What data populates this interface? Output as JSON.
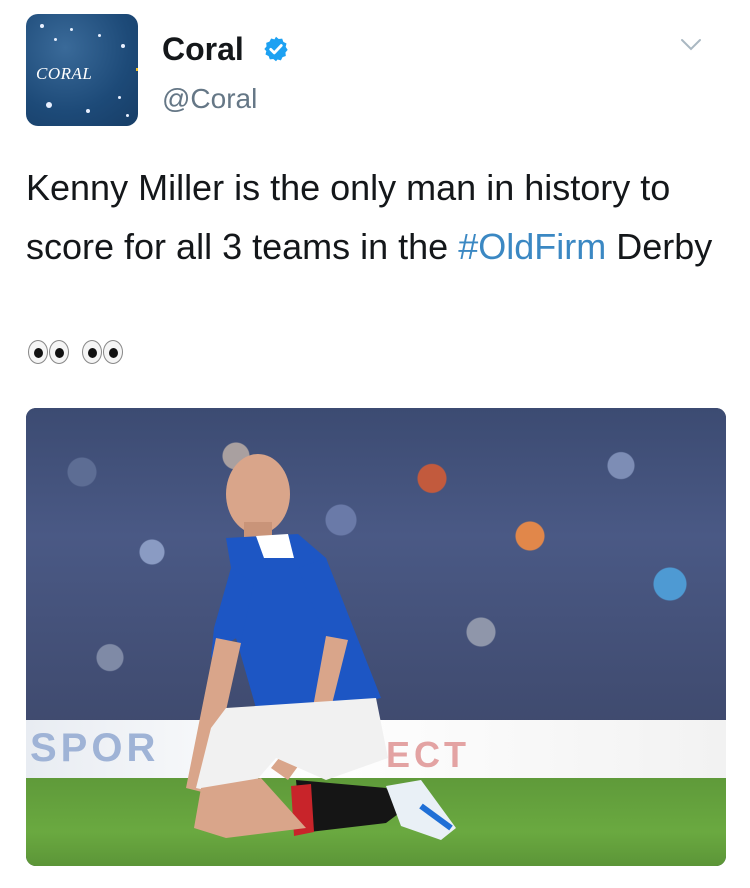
{
  "author": {
    "display_name": "Coral",
    "handle": "@Coral",
    "avatar_text": "CORAL",
    "verified": true
  },
  "tweet": {
    "text_part1": "Kenny Miller is the only man in history to score for all 3 teams in the ",
    "hashtag": "#OldFirm",
    "text_part2": " Derby",
    "emoji": [
      "eyes-emoji",
      "eyes-emoji"
    ]
  },
  "media": {
    "board_text_left": "SPOR",
    "board_text_right": "ECT"
  },
  "colors": {
    "hashtag": "#3b88c3",
    "verified": "#1da1f2",
    "handle": "#657786",
    "text": "#14171a"
  },
  "icons": {
    "verified": "verified-badge-icon",
    "menu": "chevron-down-icon"
  }
}
